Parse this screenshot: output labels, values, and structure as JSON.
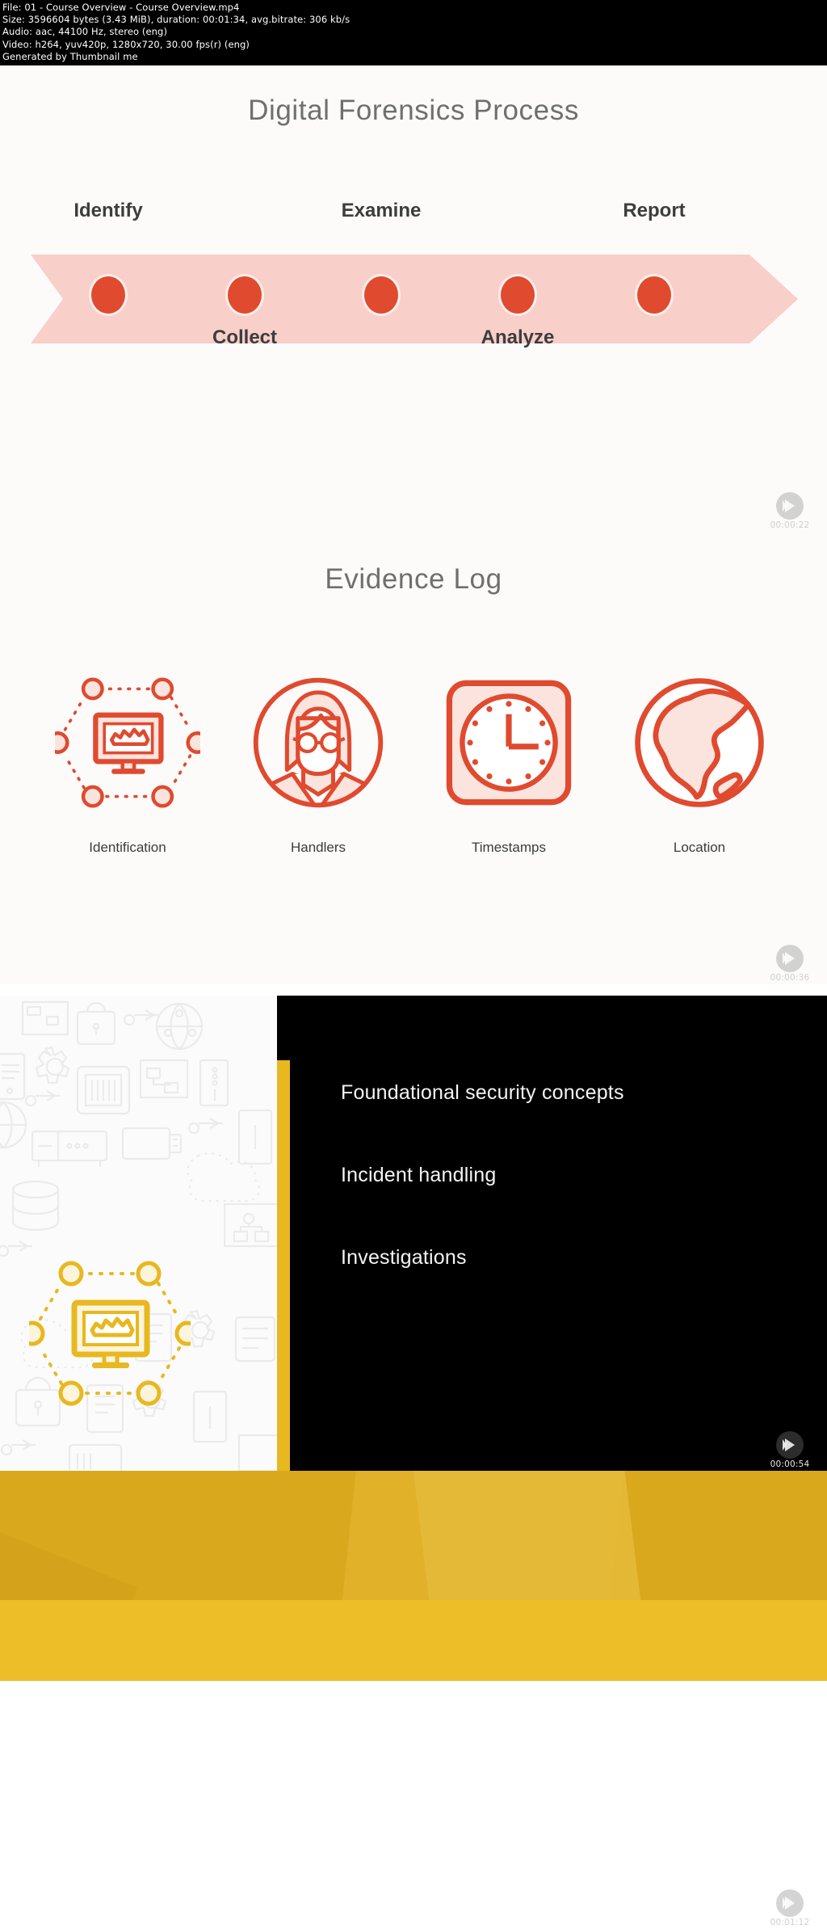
{
  "fileinfo": {
    "line1": "File: 01 - Course Overview - Course Overview.mp4",
    "line2": "Size: 3596604 bytes (3.43 MiB), duration: 00:01:34, avg.bitrate: 306 kb/s",
    "line3": "Audio: aac, 44100 Hz, stereo (eng)",
    "line4": "Video: h264, yuv420p, 1280x720, 30.00 fps(r) (eng)",
    "line5": "Generated by Thumbnail me"
  },
  "colors": {
    "accent_red": "#e04a2f",
    "accent_red_pale": "#f8cfc9",
    "accent_yellow": "#e8b820",
    "yellow_band": "#edbe28",
    "yellow_photo": "#d9a81d",
    "title_grey": "#6f6f6f",
    "black": "#000000"
  },
  "slides": [
    {
      "id": "forensics-process",
      "title": "Digital Forensics Process",
      "timestamp": "00:00:22",
      "play_icon": "play-icon",
      "steps_top": [
        "Identify",
        "Examine",
        "Report"
      ],
      "steps_bottom": [
        "Collect",
        "Analyze"
      ],
      "dot_count": 5
    },
    {
      "id": "evidence-log",
      "title": "Evidence Log",
      "timestamp": "00:00:36",
      "play_icon": "play-icon",
      "items": [
        {
          "label": "Identification",
          "icon": "network-monitor-icon"
        },
        {
          "label": "Handlers",
          "icon": "person-avatar-icon"
        },
        {
          "label": "Timestamps",
          "icon": "clock-icon"
        },
        {
          "label": "Location",
          "icon": "globe-icon"
        }
      ]
    },
    {
      "id": "course-topics",
      "timestamp": "00:00:54",
      "play_icon": "play-icon",
      "side_icon": "network-monitor-icon",
      "bullets": [
        "Foundational security concepts",
        "Incident handling",
        "Investigations"
      ]
    },
    {
      "id": "yellow-photo",
      "timestamp": ""
    },
    {
      "id": "blank-white",
      "timestamp": "00:01:12",
      "play_icon": "play-icon"
    }
  ]
}
